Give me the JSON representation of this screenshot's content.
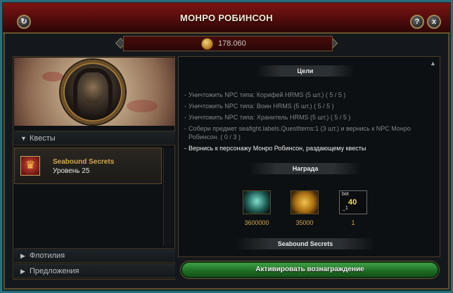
{
  "window": {
    "title": "МОНРО РОБИНСОН",
    "help_label": "?",
    "close_label": "x",
    "refresh_label": "↻"
  },
  "currency": {
    "value": "178.060",
    "icon": "coin-icon"
  },
  "left": {
    "quests_header": "Квесты",
    "quest": {
      "name": "Seabound Secrets",
      "level": "Уровень 25",
      "icon": "crown-icon"
    },
    "fleet_header": "Флотилия",
    "offers_header": "Предложения"
  },
  "details": {
    "goals_title": "Цели",
    "goals": [
      "Уничтожить NPC типа: Корифей HRMS (5 шт.) ( 5 / 5 )",
      "Уничтожить NPC типа: Воин HRMS (5 шт.) ( 5 / 5 )",
      "Уничтожить NPC типа: Хранитель HRMS (5 шт.) ( 5 / 5 )",
      "Собери предмет seafight.labels.QuestItems:1 (3 шт.) и вернись к NPC Монро Робинсон. ( 0 / 3 )",
      "Вернись к персонажу Монро Робинсон, раздающему квесты"
    ],
    "reward_title": "Награда",
    "rewards": [
      {
        "icon": "green-orb-icon",
        "qty": "3600000"
      },
      {
        "icon": "gold-bar-icon",
        "qty": "35000"
      },
      {
        "icon": "item-card-icon",
        "qty": "1",
        "card_top": "bot",
        "card_num": "40",
        "card_sub": "_1"
      }
    ],
    "set_title": "Seabound Secrets"
  },
  "actions": {
    "activate_label": "Активировать вознаграждение"
  },
  "colors": {
    "title_bar": "#7d1412",
    "accent_gold": "#d4a84a",
    "button_green": "#2f8a37",
    "frame_teal": "#2b6e7a"
  }
}
